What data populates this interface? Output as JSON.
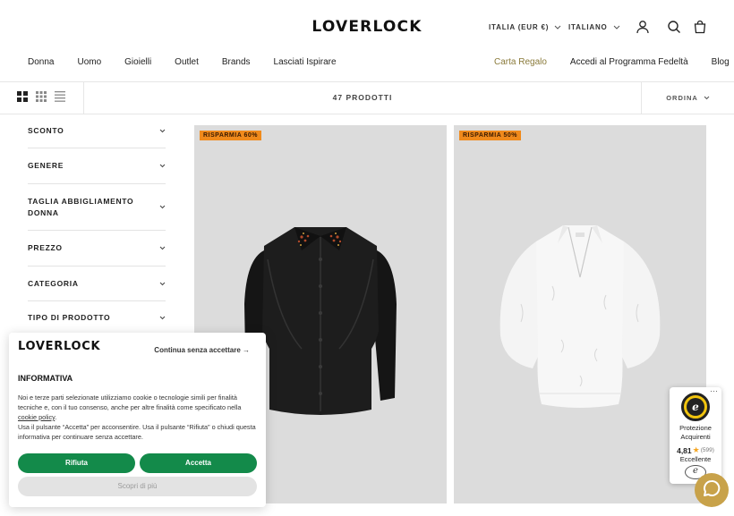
{
  "header": {
    "logo": "LOVERLOCK",
    "country_selector": "ITALIA (EUR €)",
    "language_selector": "ITALIANO"
  },
  "nav_left": [
    "Donna",
    "Uomo",
    "Gioielli",
    "Outlet",
    "Brands",
    "Lasciati Ispirare"
  ],
  "nav_right": {
    "gift_card": "Carta Regalo",
    "loyalty": "Accedi al Programma Fedeltà",
    "blog": "Blog"
  },
  "toolbar": {
    "product_count": "47 PRODOTTI",
    "sort_label": "ORDINA"
  },
  "filters": [
    "SCONTO",
    "GENERE",
    "TAGLIA ABBIGLIAMENTO DONNA",
    "PREZZO",
    "CATEGORIA",
    "TIPO DI PRODOTTO"
  ],
  "products": [
    {
      "badge": "RISPARMIA 60%"
    },
    {
      "badge": "RISPARMIA 50%"
    }
  ],
  "cookie": {
    "logo": "LOVERLOCK",
    "skip": "Continua senza accettare →",
    "title": "INFORMATIVA",
    "text_1": "Noi e terze parti selezionate utilizziamo cookie o tecnologie simili per finalità tecniche e, con il tuo consenso, anche per altre finalità come specificato nella ",
    "link": "cookie policy",
    "text_1_end": ".",
    "text_2": "Usa il pulsante “Accetta” per acconsentire. Usa il pulsante “Rifiuta” o chiudi questa informativa per continuare senza accettare.",
    "reject": "Rifiuta",
    "accept": "Accetta",
    "more": "Scopri di più"
  },
  "trust": {
    "title": "Protezione Acquirenti",
    "score": "4,81",
    "count": "(599)",
    "label": "Eccellente"
  },
  "colors": {
    "badge": "#f08a1c",
    "accent_green": "#138a4a",
    "gift_card": "#8a7a3a",
    "chat": "#c8a24a"
  }
}
